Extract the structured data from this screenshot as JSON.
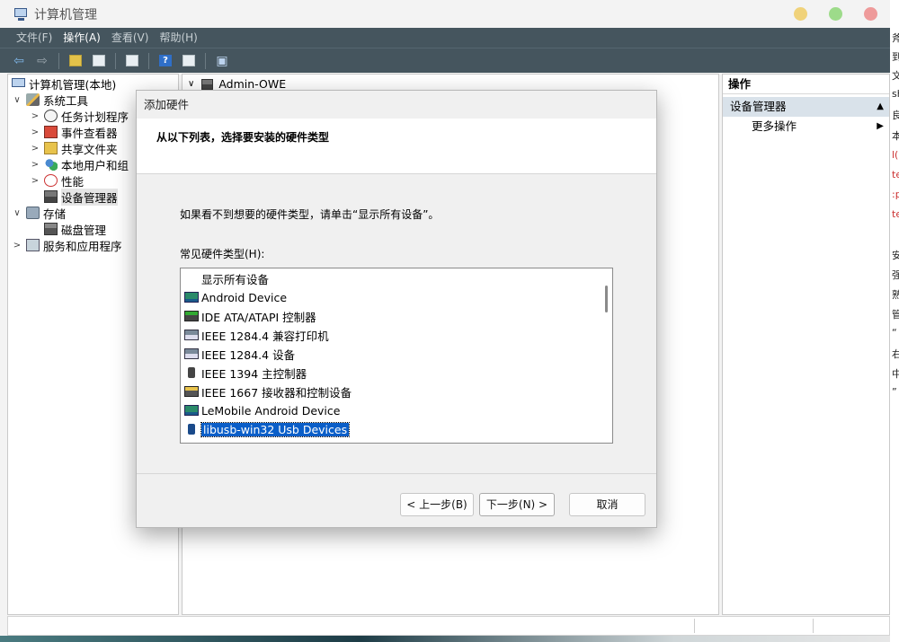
{
  "window": {
    "title": "计算机管理",
    "controls": {
      "minimize_color": "#f0d27a",
      "maximize_color": "#9ddb8a",
      "close_color": "#ee9a9a"
    }
  },
  "menu": [
    "文件(F)",
    "操作(A)",
    "查看(V)",
    "帮助(H)"
  ],
  "toolbar": [
    "back-icon",
    "forward-icon",
    "folder-up-icon",
    "view-icon",
    "properties-icon",
    "help-icon",
    "refresh-icon",
    "computer-icon"
  ],
  "tree": [
    {
      "label": "计算机管理(本地)",
      "icon": "computer-icon",
      "expander": ""
    },
    {
      "label": "系统工具",
      "icon": "tools-icon",
      "expander": "∨"
    },
    {
      "label": "任务计划程序",
      "icon": "clock-icon",
      "expander": ">"
    },
    {
      "label": "事件查看器",
      "icon": "event-icon",
      "expander": ">"
    },
    {
      "label": "共享文件夹",
      "icon": "share-icon",
      "expander": ">"
    },
    {
      "label": "本地用户和组",
      "icon": "users-icon",
      "expander": ">"
    },
    {
      "label": "性能",
      "icon": "performance-icon",
      "expander": ">"
    },
    {
      "label": "设备管理器",
      "icon": "device-manager-icon",
      "expander": ""
    },
    {
      "label": "存储",
      "icon": "storage-icon",
      "expander": "∨"
    },
    {
      "label": "磁盘管理",
      "icon": "disk-icon",
      "expander": ""
    },
    {
      "label": "服务和应用程序",
      "icon": "services-icon",
      "expander": ">"
    }
  ],
  "center": {
    "root_label": "Admin-OWE"
  },
  "actions": {
    "header": "操作",
    "section": "设备管理器",
    "more": "更多操作"
  },
  "dialog": {
    "title": "添加硬件",
    "heading": "从以下列表，选择要安装的硬件类型",
    "hint": "如果看不到想要的硬件类型，请单击“显示所有设备”。",
    "list_label": "常见硬件类型(H):",
    "items": [
      {
        "label": "显示所有设备",
        "icon": ""
      },
      {
        "label": "Android Device",
        "icon": "android-device-icon"
      },
      {
        "label": "IDE ATA/ATAPI 控制器",
        "icon": "ide-controller-icon"
      },
      {
        "label": "IEEE 1284.4 兼容打印机",
        "icon": "printer-icon"
      },
      {
        "label": "IEEE 1284.4 设备",
        "icon": "printer-icon"
      },
      {
        "label": "IEEE 1394 主控制器",
        "icon": "usb-icon"
      },
      {
        "label": "IEEE 1667 接收器和控制设备",
        "icon": "ieee1667-icon"
      },
      {
        "label": "LeMobile Android Device",
        "icon": "android-device-icon"
      },
      {
        "label": "libusb-win32 Usb Devices",
        "icon": "usb-icon",
        "selected": true
      }
    ],
    "buttons": {
      "back": "< 上一步(B)",
      "next": "下一步(N) >",
      "cancel": "取消"
    }
  },
  "desktop_edge_text": [
    "斧",
    "到",
    "文",
    "sh",
    "良",
    "本",
    "l(",
    "te",
    ":p",
    "te",
    "安",
    "强",
    "熟",
    "管",
    "“",
    "右",
    "中",
    "”"
  ]
}
